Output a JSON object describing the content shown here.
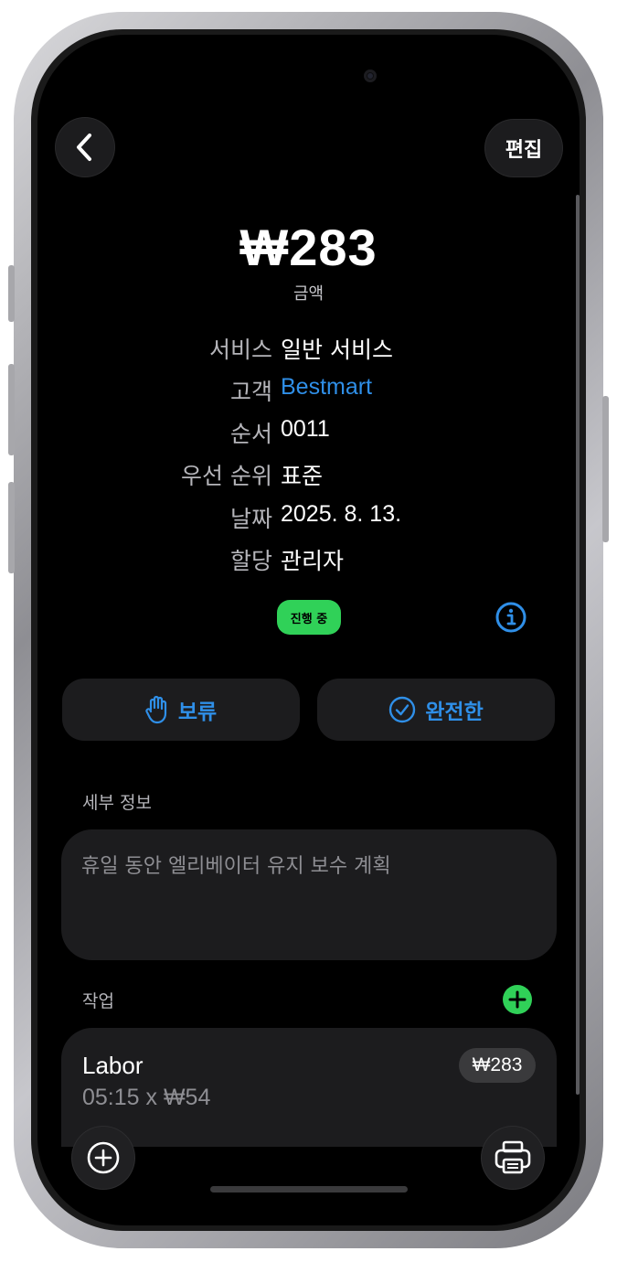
{
  "header": {
    "back_icon": "chevron-left-icon",
    "edit_label": "편집"
  },
  "summary": {
    "amount": "₩283",
    "amount_label": "금액"
  },
  "info_rows": [
    {
      "key": "서비스",
      "value": "일반 서비스"
    },
    {
      "key": "고객",
      "value": "Bestmart"
    },
    {
      "key": "순서",
      "value": "0011"
    },
    {
      "key": "우선 순위",
      "value": "표준"
    },
    {
      "key": "날짜",
      "value": "2025. 8. 13."
    },
    {
      "key": "할당",
      "value": "관리자"
    }
  ],
  "status": {
    "label": "진행 중",
    "color": "#30d158",
    "info_icon": "info-circle-icon"
  },
  "actions": {
    "hold_label": "보류",
    "hold_icon": "hand-raised-icon",
    "complete_label": "완전한",
    "complete_icon": "checkmark-circle-icon",
    "accent_color": "#2f8fe8"
  },
  "details": {
    "section_label": "세부 정보",
    "text": "휴일 동안 엘리베이터 유지 보수 계획"
  },
  "tasks": {
    "section_label": "작업",
    "add_icon": "plus-circle-icon",
    "items": [
      {
        "title": "Labor",
        "subtitle": "05:15 x ₩54",
        "price": "₩283"
      }
    ]
  },
  "bottom": {
    "add_icon": "plus-circle-icon",
    "print_icon": "printer-icon"
  }
}
